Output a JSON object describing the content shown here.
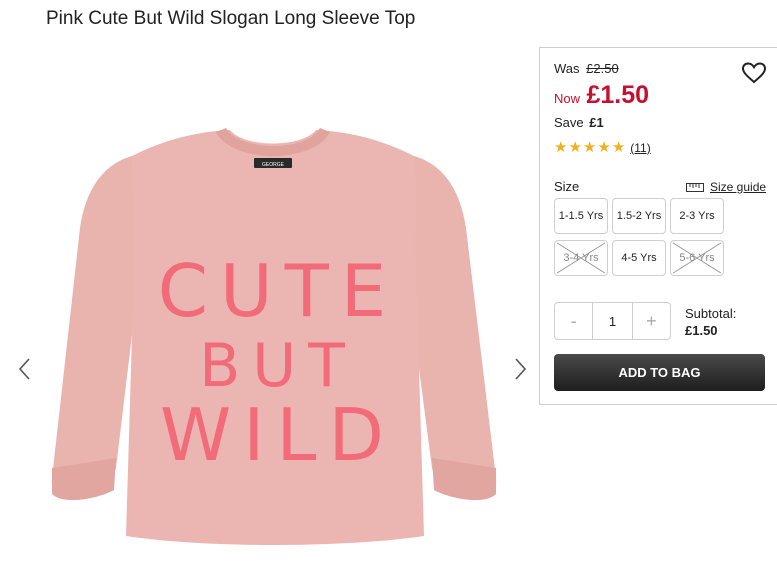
{
  "product": {
    "title": "Pink Cute But Wild Slogan Long Sleeve Top",
    "image_alt": "Pink long sleeve top with CUTE BUT WILD slogan",
    "slogan_lines": [
      "CUTE",
      "BUT",
      "WILD"
    ],
    "neck_tag": "GEORGE"
  },
  "pricing": {
    "was_label": "Was",
    "was_price": "£2.50",
    "now_label": "Now",
    "now_price": "£1.50",
    "save_label": "Save",
    "save_amount": "£1"
  },
  "rating": {
    "stars": 5,
    "reviews": "(11)"
  },
  "size": {
    "label": "Size",
    "guide_label": "Size guide",
    "options": [
      {
        "label": "1-1.5 Yrs",
        "available": true
      },
      {
        "label": "1.5-2 Yrs",
        "available": true
      },
      {
        "label": "2-3 Yrs",
        "available": true
      },
      {
        "label": "3-4 Yrs",
        "available": false
      },
      {
        "label": "4-5 Yrs",
        "available": true
      },
      {
        "label": "5-6 Yrs",
        "available": false
      }
    ]
  },
  "quantity": {
    "minus": "-",
    "value": "1",
    "plus": "+"
  },
  "subtotal": {
    "label": "Subtotal:",
    "amount": "£1.50"
  },
  "cta": {
    "add_to_bag": "ADD TO BAG"
  },
  "colors": {
    "price_red": "#c8102e",
    "star_gold": "#f2b01e",
    "button_dark": "#222222",
    "shirt_pink": "#e8b1ad",
    "slogan_pink": "#f26b7a"
  },
  "icons": {
    "wishlist": "heart-outline-icon",
    "size_guide": "ruler-icon",
    "prev": "chevron-left-icon",
    "next": "chevron-right-icon"
  }
}
